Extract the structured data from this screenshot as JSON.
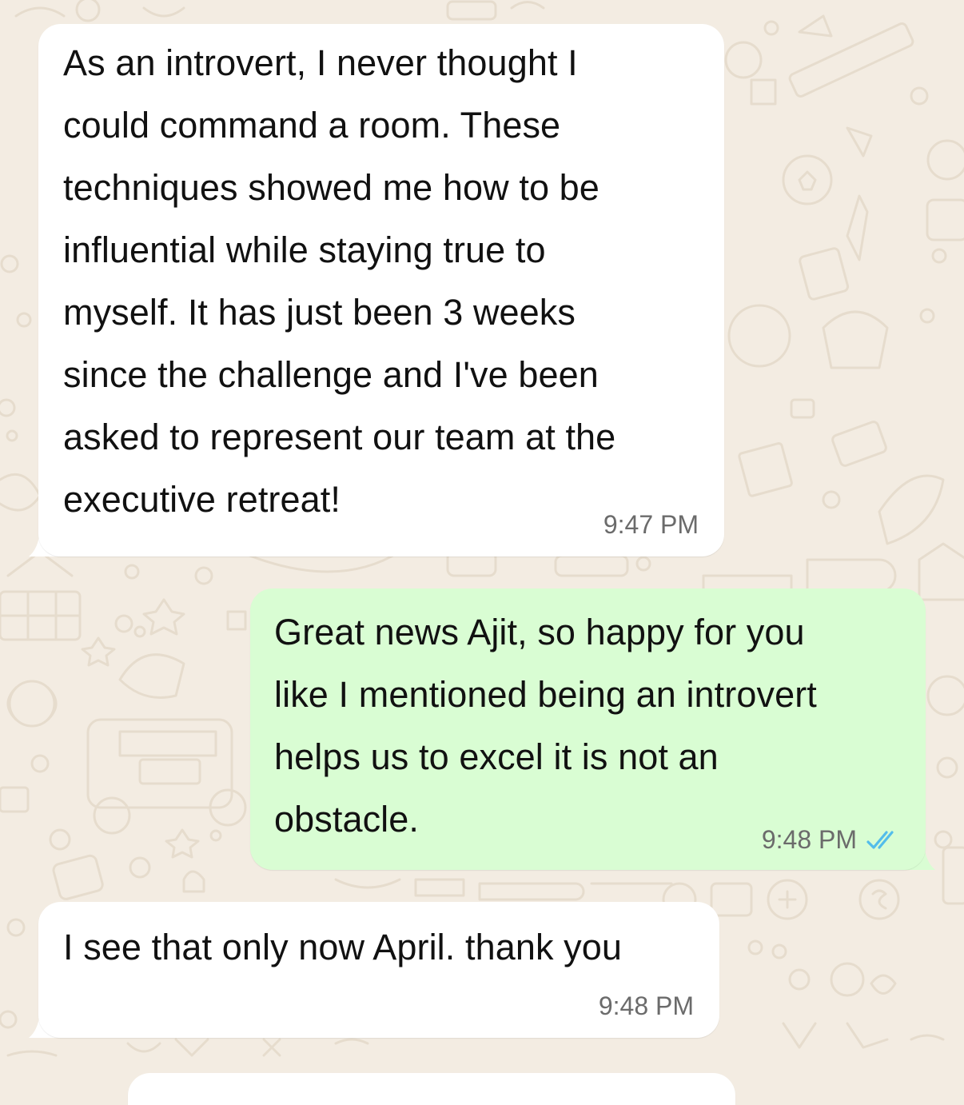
{
  "messages": [
    {
      "direction": "incoming",
      "text": "As an introvert, I never thought I\ncould command a room. These\ntechniques showed me how to be\ninfluential while staying true to\nmyself. It has just been 3 weeks\nsince the challenge and I've been\nasked to represent our team at the\nexecutive retreat!",
      "time": "9:47 PM"
    },
    {
      "direction": "outgoing",
      "text": "Great news Ajit, so happy for you\nlike I mentioned being an introvert\nhelps us to excel it is not an\nobstacle.",
      "time": "9:48 PM",
      "status": "read"
    },
    {
      "direction": "incoming",
      "text": "I see that only now April. thank you",
      "time": "9:48 PM"
    }
  ],
  "colors": {
    "background": "#f3ece2",
    "incoming_bubble": "#ffffff",
    "outgoing_bubble": "#d9fdd3",
    "read_ticks": "#53bdeb",
    "timestamp": "#6b6b6b"
  },
  "icons": {
    "read_receipt": "double-check-icon"
  }
}
